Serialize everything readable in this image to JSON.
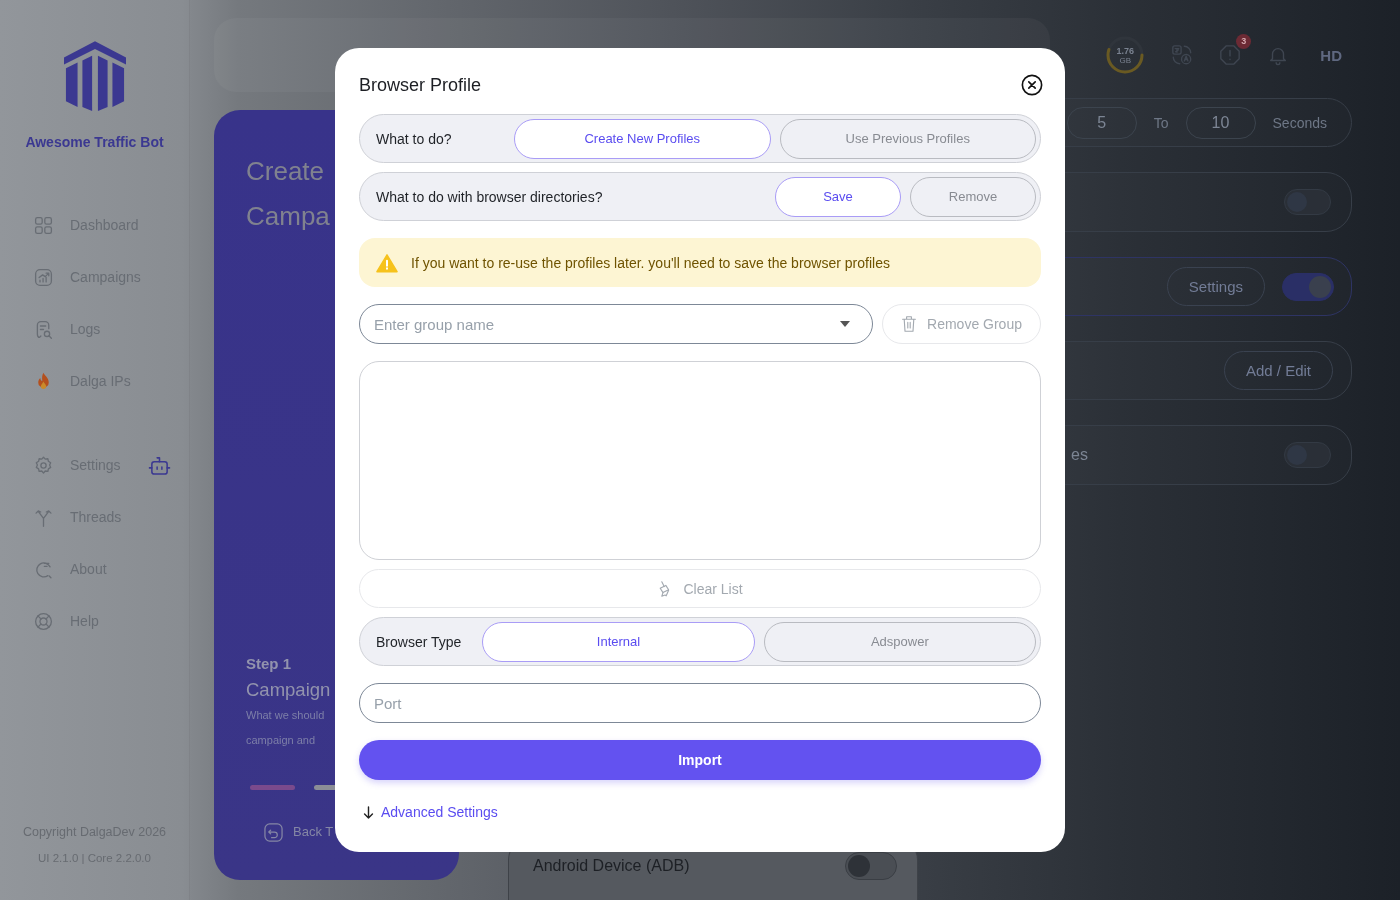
{
  "sidebar": {
    "brand": "Awesome Traffic Bot",
    "nav_main": [
      {
        "label": "Dashboard",
        "selected": false
      },
      {
        "label": "Campaigns",
        "selected": false
      },
      {
        "label": "Logs",
        "selected": false
      },
      {
        "label": "Dalga IPs",
        "selected": false
      }
    ],
    "nav_secondary": [
      {
        "label": "Settings",
        "selected": false
      },
      {
        "label": "Threads",
        "selected": false
      },
      {
        "label": "About",
        "selected": false
      },
      {
        "label": "Help",
        "selected": false
      }
    ],
    "copyright": "Copyright DalgaDev 2026",
    "version": "UI 2.1.0 | Core 2.2.0.0"
  },
  "topbar": {
    "disk_usage": {
      "value": "1.76",
      "unit": "GB",
      "level": 0.55
    },
    "alert_count": "3",
    "user_initials": "HD"
  },
  "campaign_panel": {
    "title": "Create Campa",
    "step": "Step 1",
    "step_title": "Campaign",
    "description": "What we should campaign and",
    "progress_steps": [
      {
        "active": true
      },
      {
        "active": false
      }
    ],
    "back_link": "Back T"
  },
  "settings_rows": [
    {
      "kind": "delay",
      "from": "5",
      "to_label": "To",
      "to": "10",
      "unit": "Seconds"
    },
    {
      "kind": "toggle",
      "on": false
    },
    {
      "kind": "button_toggle",
      "button": "Settings",
      "on": true
    },
    {
      "kind": "button",
      "button": "Add / Edit"
    },
    {
      "kind": "toggle",
      "label": "es",
      "on": false
    }
  ],
  "android_row": {
    "label": "Android Device (ADB)",
    "on": false
  },
  "modal": {
    "title": "Browser Profile",
    "profile_action": {
      "label": "What to do?",
      "options": [
        {
          "label": "Create New Profiles",
          "selected": true
        },
        {
          "label": "Use Previous Profiles",
          "selected": false
        }
      ]
    },
    "directory_action": {
      "label": "What to do with browser directories?",
      "options": [
        {
          "label": "Save",
          "selected": true
        },
        {
          "label": "Remove",
          "selected": false
        }
      ]
    },
    "warning": "If you want to re-use the profiles later. you'll need to save the browser profiles",
    "group_select": {
      "placeholder": "Enter group name"
    },
    "remove_group_button": {
      "label": "Remove Group",
      "disabled": true
    },
    "clear_list_button": {
      "label": "Clear List",
      "disabled": true
    },
    "browser_type": {
      "label": "Browser Type",
      "options": [
        {
          "label": "Internal",
          "selected": true
        },
        {
          "label": "Adspower",
          "selected": false
        }
      ]
    },
    "port_field": {
      "placeholder": "Port"
    },
    "import_button": "Import",
    "advanced_settings_link": "Advanced Settings"
  }
}
